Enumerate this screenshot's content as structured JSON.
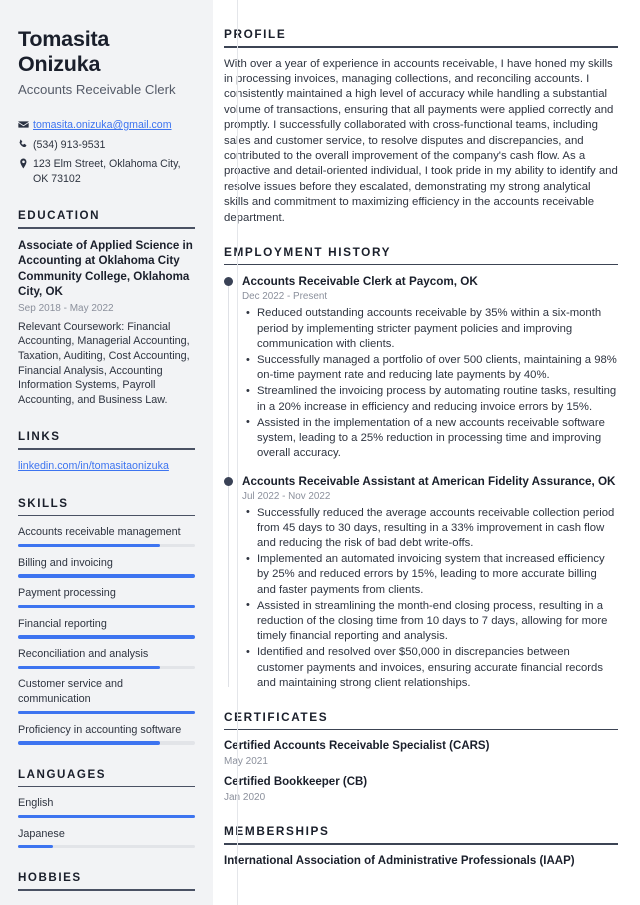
{
  "theme": {
    "accent": "#3d74f0",
    "sidebar_bg": "#f2f3f5",
    "heading_color": "#1a1f2b",
    "muted_color": "#8b909c",
    "dot_color": "#3a4256"
  },
  "sidebar": {
    "name": "Tomasita Onizuka",
    "job_title": "Accounts Receivable Clerk",
    "contacts": [
      {
        "icon": "envelope-icon",
        "text": "tomasita.onizuka@gmail.com",
        "is_link": true
      },
      {
        "icon": "phone-icon",
        "text": "(534) 913-9531",
        "is_link": false
      },
      {
        "icon": "location-pin-icon",
        "text": "123 Elm Street, Oklahoma City, OK 73102",
        "is_link": false
      }
    ],
    "education": {
      "heading": "EDUCATION",
      "degree": "Associate of Applied Science in Accounting at Oklahoma City Community College, Oklahoma City, OK",
      "dates": "Sep 2018 - May 2022",
      "description": "Relevant Coursework: Financial Accounting, Managerial Accounting, Taxation, Auditing, Cost Accounting, Financial Analysis, Accounting Information Systems, Payroll Accounting, and Business Law."
    },
    "links": {
      "heading": "LINKS",
      "items": [
        {
          "label": "linkedin.com/in/tomasitaonizuka"
        }
      ]
    },
    "skills": {
      "heading": "SKILLS",
      "items": [
        {
          "label": "Accounts receivable management",
          "level": 80
        },
        {
          "label": "Billing and invoicing",
          "level": 100
        },
        {
          "label": "Payment processing",
          "level": 100
        },
        {
          "label": "Financial reporting",
          "level": 100
        },
        {
          "label": "Reconciliation and analysis",
          "level": 80
        },
        {
          "label": "Customer service and communication",
          "level": 100
        },
        {
          "label": "Proficiency in accounting software",
          "level": 80
        }
      ]
    },
    "languages": {
      "heading": "LANGUAGES",
      "items": [
        {
          "label": "English",
          "level": 100
        },
        {
          "label": "Japanese",
          "level": 20
        }
      ]
    },
    "hobbies": {
      "heading": "HOBBIES"
    }
  },
  "main": {
    "profile": {
      "heading": "PROFILE",
      "text": "With over a year of experience in accounts receivable, I have honed my skills in processing invoices, managing collections, and reconciling accounts. I consistently maintained a high level of accuracy while handling a substantial volume of transactions, ensuring that all payments were applied correctly and promptly. I successfully collaborated with cross-functional teams, including sales and customer service, to resolve disputes and discrepancies, and contributed to the overall improvement of the company's cash flow. As a proactive and detail-oriented individual, I took pride in my ability to identify and resolve issues before they escalated, demonstrating my strong analytical skills and commitment to maximizing efficiency in the accounts receivable department."
    },
    "employment": {
      "heading": "EMPLOYMENT HISTORY",
      "entries": [
        {
          "title": "Accounts Receivable Clerk at Paycom, OK",
          "dates": "Dec 2022 - Present",
          "bullets": [
            "Reduced outstanding accounts receivable by 35% within a six-month period by implementing stricter payment policies and improving communication with clients.",
            "Successfully managed a portfolio of over 500 clients, maintaining a 98% on-time payment rate and reducing late payments by 40%.",
            "Streamlined the invoicing process by automating routine tasks, resulting in a 20% increase in efficiency and reducing invoice errors by 15%.",
            "Assisted in the implementation of a new accounts receivable software system, leading to a 25% reduction in processing time and improving overall accuracy."
          ]
        },
        {
          "title": "Accounts Receivable Assistant at American Fidelity Assurance, OK",
          "dates": "Jul 2022 - Nov 2022",
          "bullets": [
            "Successfully reduced the average accounts receivable collection period from 45 days to 30 days, resulting in a 33% improvement in cash flow and reducing the risk of bad debt write-offs.",
            "Implemented an automated invoicing system that increased efficiency by 25% and reduced errors by 15%, leading to more accurate billing and faster payments from clients.",
            "Assisted in streamlining the month-end closing process, resulting in a reduction of the closing time from 10 days to 7 days, allowing for more timely financial reporting and analysis.",
            "Identified and resolved over $50,000 in discrepancies between customer payments and invoices, ensuring accurate financial records and maintaining strong client relationships."
          ]
        }
      ]
    },
    "certificates": {
      "heading": "CERTIFICATES",
      "items": [
        {
          "name": "Certified Accounts Receivable Specialist (CARS)",
          "date": "May 2021"
        },
        {
          "name": "Certified Bookkeeper (CB)",
          "date": "Jan 2020"
        }
      ]
    },
    "memberships": {
      "heading": "MEMBERSHIPS",
      "items": [
        {
          "name": "International Association of Administrative Professionals (IAAP)"
        }
      ]
    }
  }
}
